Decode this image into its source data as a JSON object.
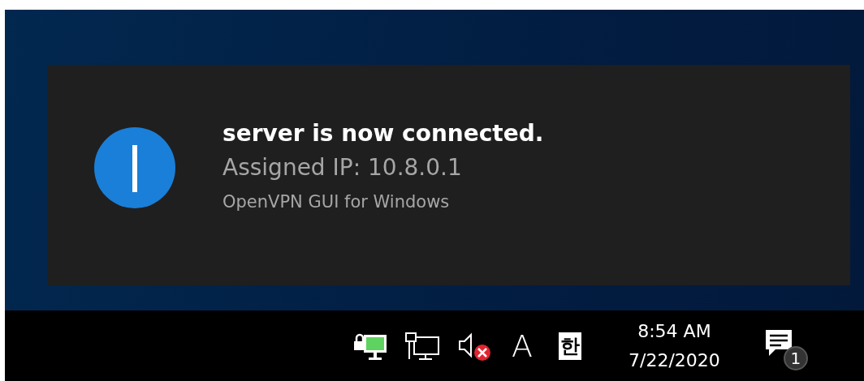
{
  "notification": {
    "title": "server is now connected.",
    "message": "Assigned IP: 10.8.0.1",
    "source": "OpenVPN GUI for Windows"
  },
  "taskbar": {
    "input_mode": "A",
    "ime": "한",
    "time": "8:54 AM",
    "date": "7/22/2020",
    "notification_count": "1"
  }
}
